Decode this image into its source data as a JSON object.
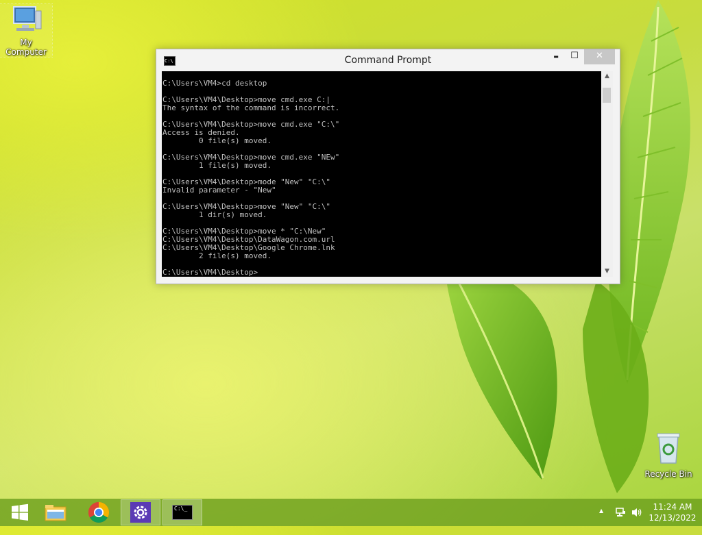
{
  "desktop": {
    "icons": [
      {
        "label": "My Computer"
      },
      {
        "label": "Recycle Bin"
      }
    ]
  },
  "window": {
    "title": "Command Prompt",
    "icon_text": "C:\\",
    "minimize_glyph": "▬",
    "maximize_glyph": "☐",
    "close_glyph": "✕",
    "scroll_up_glyph": "▲",
    "scroll_down_glyph": "▼",
    "console": [
      "",
      "C:\\Users\\VM4>cd desktop",
      "",
      "C:\\Users\\VM4\\Desktop>move cmd.exe C:|",
      "The syntax of the command is incorrect.",
      "",
      "C:\\Users\\VM4\\Desktop>move cmd.exe \"C:\\\"",
      "Access is denied.",
      "        0 file(s) moved.",
      "",
      "C:\\Users\\VM4\\Desktop>move cmd.exe \"NEw\"",
      "        1 file(s) moved.",
      "",
      "C:\\Users\\VM4\\Desktop>mode \"New\" \"C:\\\"",
      "Invalid parameter - \"New\"",
      "",
      "C:\\Users\\VM4\\Desktop>move \"New\" \"C:\\\"",
      "        1 dir(s) moved.",
      "",
      "C:\\Users\\VM4\\Desktop>move * \"C:\\New\"",
      "C:\\Users\\VM4\\Desktop\\DataWagon.com.url",
      "C:\\Users\\VM4\\Desktop\\Google Chrome.lnk",
      "        2 file(s) moved.",
      "",
      "C:\\Users\\VM4\\Desktop>"
    ]
  },
  "taskbar": {
    "items": [
      {
        "icon": "windows-start-icon",
        "active": false
      },
      {
        "icon": "file-explorer-icon",
        "active": false
      },
      {
        "icon": "chrome-icon",
        "active": false
      },
      {
        "icon": "settings-gear-icon",
        "active": true
      },
      {
        "icon": "command-prompt-icon",
        "active": true
      }
    ],
    "cmd_icon_text": "C:\\_",
    "tray": {
      "chevron": "▲",
      "time": "11:24 AM",
      "date": "12/13/2022"
    }
  },
  "colors": {
    "console_bg": "#000000",
    "console_fg": "#c0c0c0",
    "settings_purple": "#5b3bb5"
  }
}
